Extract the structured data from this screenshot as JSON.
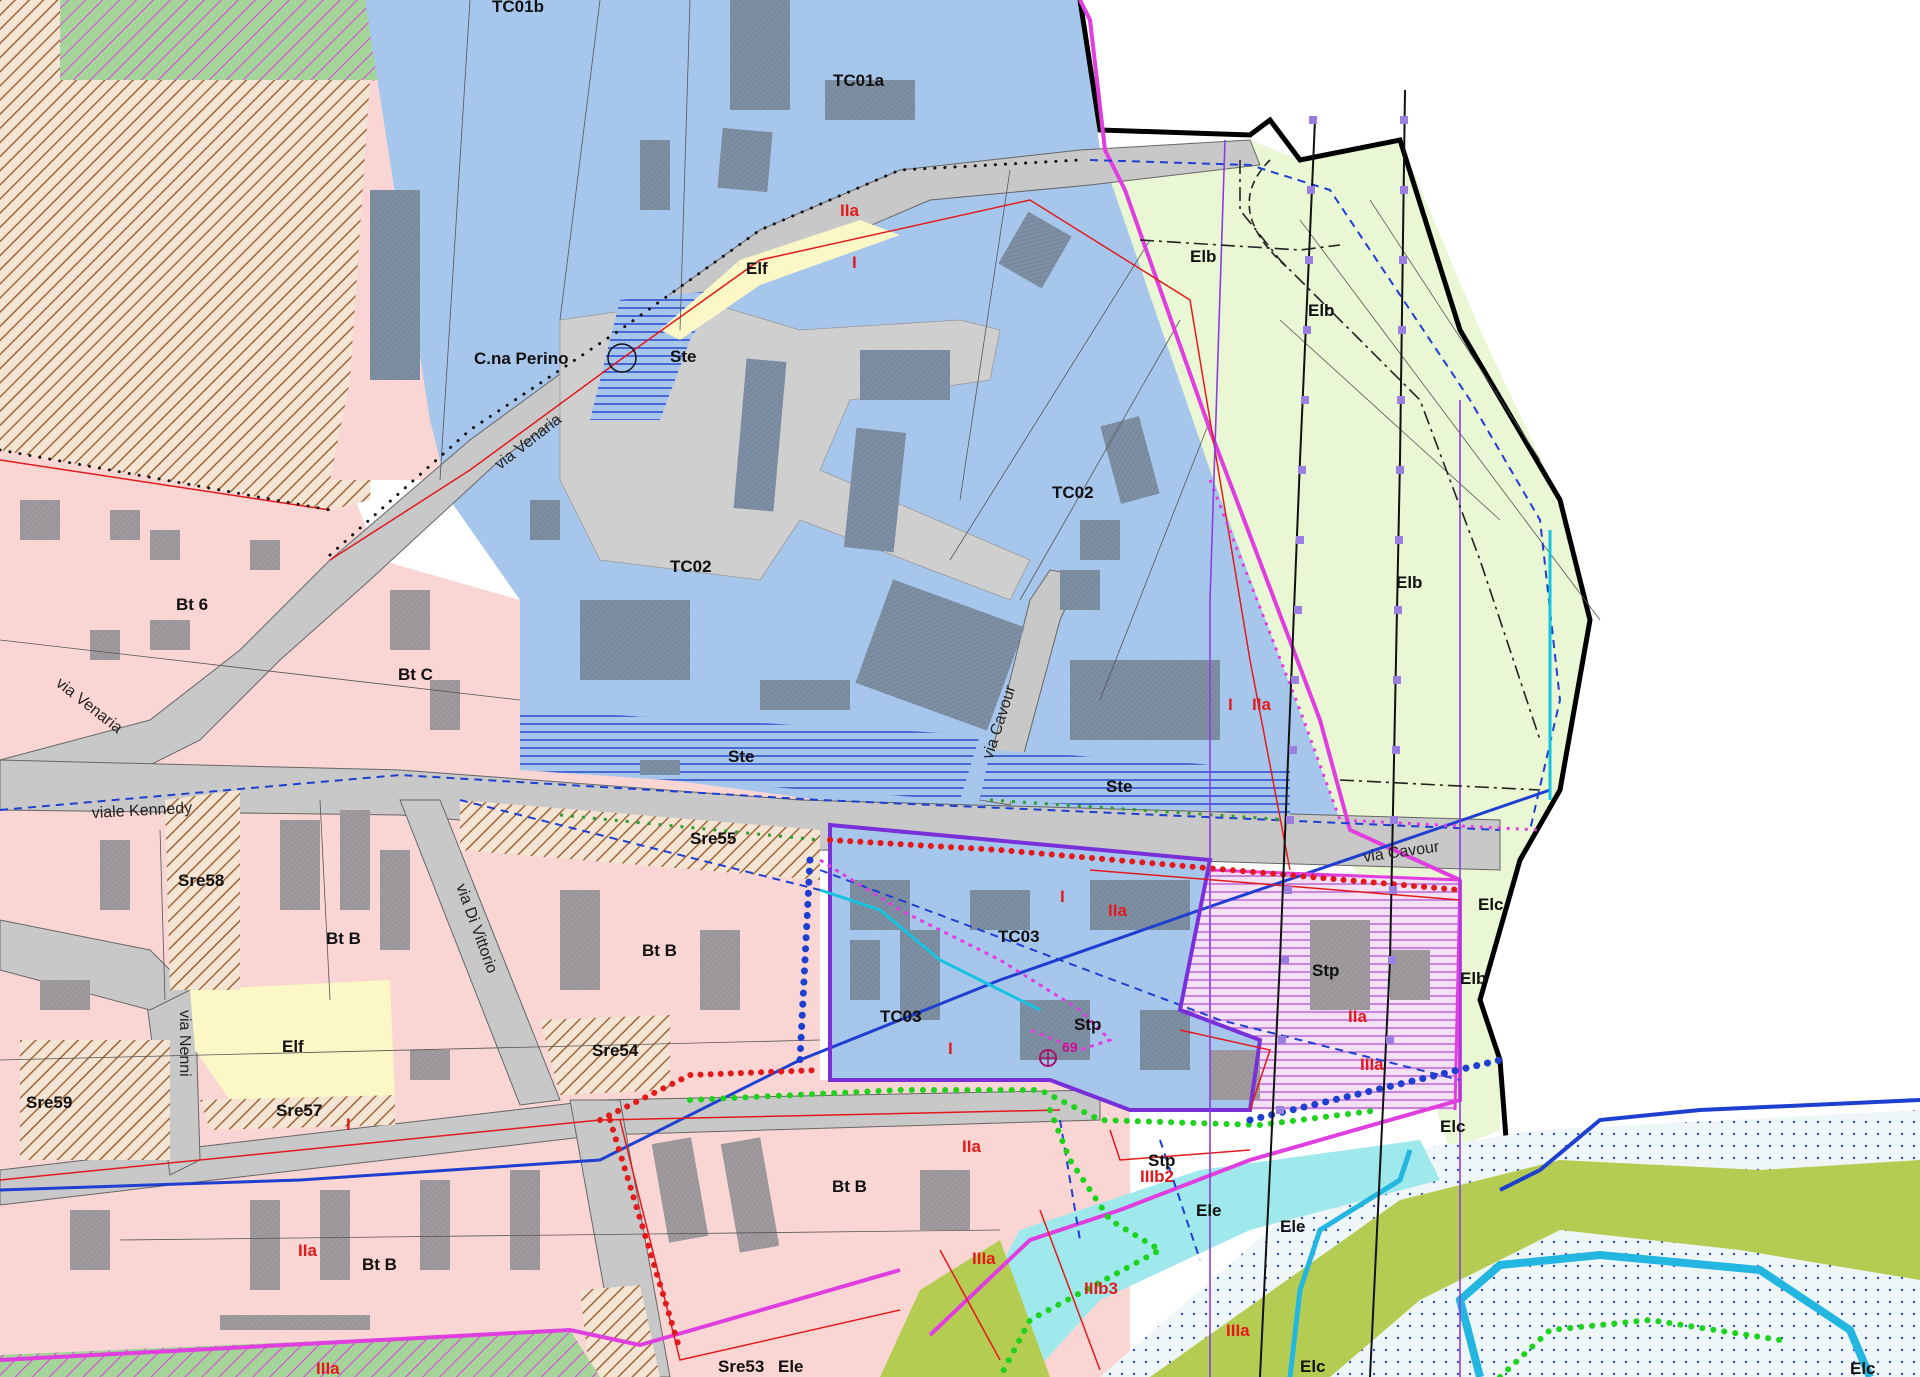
{
  "zones": [
    {
      "id": "TC01b",
      "label": "TC01b"
    },
    {
      "id": "TC01a",
      "label": "TC01a"
    },
    {
      "id": "TC02a",
      "label": "TC02"
    },
    {
      "id": "TC02b",
      "label": "TC02"
    },
    {
      "id": "TC03a",
      "label": "TC03"
    },
    {
      "id": "TC03b",
      "label": "TC03"
    },
    {
      "id": "Elf_a",
      "label": "Elf"
    },
    {
      "id": "Elf_b",
      "label": "Elf"
    },
    {
      "id": "Ste_a",
      "label": "Ste"
    },
    {
      "id": "Ste_b",
      "label": "Ste"
    },
    {
      "id": "Ste_c",
      "label": "Ste"
    },
    {
      "id": "Elb_a",
      "label": "Elb"
    },
    {
      "id": "Elb_b",
      "label": "Elb"
    },
    {
      "id": "Elb_c",
      "label": "Elb"
    },
    {
      "id": "Elb_d",
      "label": "Elb"
    },
    {
      "id": "BtC",
      "label": "Bt C"
    },
    {
      "id": "Bt6",
      "label": "Bt 6"
    },
    {
      "id": "BtB_a",
      "label": "Bt B"
    },
    {
      "id": "BtB_b",
      "label": "Bt B"
    },
    {
      "id": "BtB_c",
      "label": "Bt B"
    },
    {
      "id": "BtB_d",
      "label": "Bt B"
    },
    {
      "id": "Sre55",
      "label": "Sre55"
    },
    {
      "id": "Sre58",
      "label": "Sre58"
    },
    {
      "id": "Sre54",
      "label": "Sre54"
    },
    {
      "id": "Sre59",
      "label": "Sre59"
    },
    {
      "id": "Sre57",
      "label": "Sre57"
    },
    {
      "id": "Sre53",
      "label": "Sre53"
    },
    {
      "id": "Stp_a",
      "label": "Stp"
    },
    {
      "id": "Stp_b",
      "label": "Stp"
    },
    {
      "id": "Stp_c",
      "label": "Stp"
    },
    {
      "id": "Elc_a",
      "label": "Elc"
    },
    {
      "id": "Elc_b",
      "label": "Elc"
    },
    {
      "id": "Elc_c",
      "label": "Elc"
    },
    {
      "id": "Elc_d",
      "label": "Elc"
    },
    {
      "id": "Ele_a",
      "label": "Ele"
    },
    {
      "id": "Ele_b",
      "label": "Ele"
    },
    {
      "id": "Ele_c",
      "label": "Ele"
    },
    {
      "id": "CnaPerino",
      "label": "C.na Perino"
    }
  ],
  "hazard_classes": [
    {
      "id": "IIa_1",
      "label": "IIa"
    },
    {
      "id": "IIa_2",
      "label": "IIa"
    },
    {
      "id": "IIa_3",
      "label": "IIa"
    },
    {
      "id": "IIa_4",
      "label": "IIa"
    },
    {
      "id": "IIa_5",
      "label": "IIa"
    },
    {
      "id": "IIa_6",
      "label": "IIa"
    },
    {
      "id": "I_1",
      "label": "I"
    },
    {
      "id": "I_2",
      "label": "I"
    },
    {
      "id": "I_3",
      "label": "I"
    },
    {
      "id": "I_4",
      "label": "I"
    },
    {
      "id": "I_5",
      "label": "I"
    },
    {
      "id": "IIIa_1",
      "label": "IIIa"
    },
    {
      "id": "IIIa_2",
      "label": "IIIa"
    },
    {
      "id": "IIIa_3",
      "label": "IIIa"
    },
    {
      "id": "IIIa_4",
      "label": "IIIa"
    },
    {
      "id": "IIIb2",
      "label": "IIIb2"
    },
    {
      "id": "IIIb3",
      "label": "IIIb3"
    }
  ],
  "streets": [
    {
      "id": "via_venaria_1",
      "label": "via Venaria"
    },
    {
      "id": "via_venaria_2",
      "label": "via Venaria"
    },
    {
      "id": "viale_kennedy",
      "label": "viale Kennedy"
    },
    {
      "id": "via_di_vittorio",
      "label": "via Di Vittorio"
    },
    {
      "id": "via_cavour_1",
      "label": "via Cavour"
    },
    {
      "id": "via_cavour_2",
      "label": "via Cavour"
    },
    {
      "id": "via_nenni",
      "label": "via Nenni"
    }
  ],
  "markers": [
    {
      "id": "marker_69",
      "label": "69"
    }
  ],
  "colors": {
    "residential": "#f9d6d3",
    "tertiary": "#a7c6ec",
    "road": "#c8c8c8",
    "agricultural": "#e9f7d4",
    "park": "#fbf7c6",
    "riparian": "#9fe9ec",
    "river_green": "#b5cc52",
    "hatch_brown": "#a0673a",
    "boundary_magenta": "#e13ee0",
    "boundary_blue": "#1f3fd0",
    "boundary_purple": "#7a30d8",
    "hazard_red": "#e31a1c"
  }
}
